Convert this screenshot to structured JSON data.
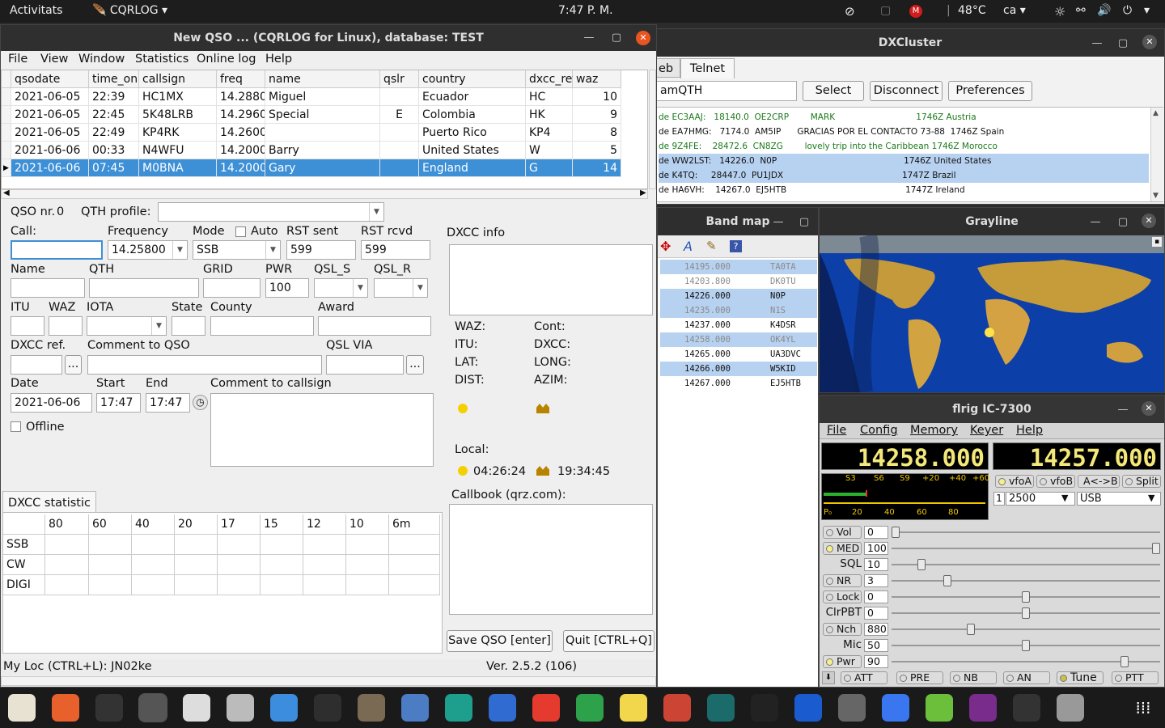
{
  "topbar": {
    "activities": "Activitats",
    "app": "CQRLOG",
    "clock": "7:47 P. M.",
    "temp": "48°C",
    "lang": "ca"
  },
  "qso_window": {
    "title": "New QSO ... (CQRLOG for Linux), database: TEST",
    "menu": [
      "File",
      "View",
      "Window",
      "Statistics",
      "Online log",
      "Help"
    ],
    "grid": {
      "headers": [
        "qsodate",
        "time_on",
        "callsign",
        "freq",
        "name",
        "qslr",
        "country",
        "dxcc_ref",
        "waz"
      ],
      "rows": [
        [
          "2021-06-05",
          "22:39",
          "HC1MX",
          "14.2880",
          "Miguel",
          "",
          "Ecuador",
          "HC",
          "10"
        ],
        [
          "2021-06-05",
          "22:45",
          "5K48LRB",
          "14.2960",
          "Special",
          "E",
          "Colombia",
          "HK",
          "9"
        ],
        [
          "2021-06-05",
          "22:49",
          "KP4RK",
          "14.2600",
          "",
          "",
          "Puerto Rico",
          "KP4",
          "8"
        ],
        [
          "2021-06-06",
          "00:33",
          "N4WFU",
          "14.2000",
          "Barry",
          "",
          "United States",
          "W",
          "5"
        ],
        [
          "2021-06-06",
          "07:45",
          "M0BNA",
          "14.2000",
          "Gary",
          "",
          "England",
          "G",
          "14"
        ]
      ]
    },
    "form": {
      "qso_nr_label": "QSO nr.",
      "qso_nr": "0",
      "qth_profile_label": "QTH profile:",
      "call_label": "Call:",
      "frequency_label": "Frequency",
      "frequency": "14.25800",
      "mode_label": "Mode",
      "mode": "SSB",
      "auto_label": "Auto",
      "rst_sent_label": "RST sent",
      "rst_sent": "599",
      "rst_rcvd_label": "RST rcvd",
      "rst_rcvd": "599",
      "name_label": "Name",
      "qth_label": "QTH",
      "grid_label": "GRID",
      "pwr_label": "PWR",
      "pwr": "100",
      "qsl_s_label": "QSL_S",
      "qsl_r_label": "QSL_R",
      "itu_label": "ITU",
      "waz_label": "WAZ",
      "iota_label": "IOTA",
      "state_label": "State",
      "county_label": "County",
      "award_label": "Award",
      "dxcc_ref_label": "DXCC ref.",
      "comment_qso_label": "Comment to QSO",
      "qsl_via_label": "QSL VIA",
      "date_label": "Date",
      "date": "2021-06-06",
      "start_label": "Start",
      "start": "17:47",
      "end_label": "End",
      "end": "17:47",
      "comment_call_label": "Comment to callsign",
      "offline_label": "Offline",
      "ellipsis": "..."
    },
    "dxcc_info": {
      "title": "DXCC info",
      "waz": "WAZ:",
      "itu": "ITU:",
      "lat": "LAT:",
      "dist": "DIST:",
      "cont": "Cont:",
      "dxcc": "DXCC:",
      "long": "LONG:",
      "azim": "AZIM:",
      "local": "Local:",
      "sunrise": "04:26:24",
      "sunset": "19:34:45",
      "callbook": "Callbook (qrz.com):"
    },
    "stat": {
      "tab": "DXCC statistic",
      "bands": [
        "80",
        "60",
        "40",
        "20",
        "17",
        "15",
        "12",
        "10",
        "6m"
      ],
      "modes": [
        "SSB",
        "CW",
        "DIGI"
      ]
    },
    "save_btn": "Save QSO [enter]",
    "quit_btn": "Quit [CTRL+Q]",
    "status_left": "My Loc (CTRL+L): JN02ke",
    "status_right": "Ver. 2.5.2 (106)"
  },
  "dxcluster": {
    "title": "DXCluster",
    "tab_web": "eb",
    "tab_telnet": "Telnet",
    "host": "amQTH",
    "select": "Select",
    "disconnect": "Disconnect",
    "preferences": "Preferences",
    "lines": [
      {
        "text": "de EC3AAJ:   18140.0  OE2CRP        MARK                              1746Z Austria",
        "color": "#1a7a1a",
        "hl": false
      },
      {
        "text": "de EA7HMG:   7174.0  AM5IP      GRACIAS POR EL CONTACTO 73-88  1746Z Spain",
        "color": "#111",
        "hl": false
      },
      {
        "text": "de 9Z4FE:    28472.6  CN8ZG        lovely trip into the Caribbean 1746Z Morocco",
        "color": "#1a7a1a",
        "hl": false
      },
      {
        "text": "de WW2LST:   14226.0  N0P                                               1746Z United States",
        "color": "#111",
        "hl": true
      },
      {
        "text": "de K4TQ:     28447.0  PU1JDX                                            1747Z Brazil",
        "color": "#111",
        "hl": true
      },
      {
        "text": "de HA6VH:    14267.0  EJ5HTB                                            1747Z Ireland",
        "color": "#111",
        "hl": false
      }
    ]
  },
  "bandmap": {
    "title": "Band map",
    "rows": [
      {
        "freq": "14195.000",
        "call": "TA0TA",
        "hl": true,
        "dim": true
      },
      {
        "freq": "14203.800",
        "call": "DK0TU",
        "hl": false,
        "dim": true
      },
      {
        "freq": "14226.000",
        "call": "N0P",
        "hl": true,
        "dim": false
      },
      {
        "freq": "14235.000",
        "call": "N1S",
        "hl": true,
        "dim": true
      },
      {
        "freq": "14237.000",
        "call": "K4DSR",
        "hl": false,
        "dim": false
      },
      {
        "freq": "14258.000",
        "call": "OK4YL",
        "hl": true,
        "dim": true
      },
      {
        "freq": "14265.000",
        "call": "UA3DVC",
        "hl": false,
        "dim": false
      },
      {
        "freq": "14266.000",
        "call": "W5KID",
        "hl": true,
        "dim": false
      },
      {
        "freq": "14267.000",
        "call": "EJ5HTB",
        "hl": false,
        "dim": false
      }
    ]
  },
  "grayline": {
    "title": "Grayline"
  },
  "flrig": {
    "title": "flrig IC-7300",
    "menu": [
      "File",
      "Config",
      "Memory",
      "Keyer",
      "Help"
    ],
    "vfo_a": "14258.000",
    "vfo_b": "14257.000",
    "smeter_labels": [
      "S3",
      "S6",
      "S9",
      "+20",
      "+40",
      "+60"
    ],
    "pwr_labels": [
      "20",
      "40",
      "60",
      "80"
    ],
    "btn_vfoa": "vfoA",
    "btn_vfob": "vfoB",
    "btn_ab": "A<->B",
    "btn_split": "Split",
    "bw_idx": "1",
    "bw": "2500",
    "mode": "USB",
    "controls": [
      {
        "label": "Vol",
        "value": "0",
        "btn": true,
        "active": false,
        "pos": 0.0
      },
      {
        "label": "MED",
        "value": "100",
        "btn": true,
        "active": true,
        "pos": 1.0
      },
      {
        "label": "SQL",
        "value": "10",
        "btn": false,
        "active": false,
        "pos": 0.1
      },
      {
        "label": "NR",
        "value": "3",
        "btn": true,
        "active": false,
        "pos": 0.2
      },
      {
        "label": "Lock",
        "value": "0",
        "btn": true,
        "active": false,
        "pos": 0.5
      },
      {
        "label": "ClrPBT",
        "value": "0",
        "btn": false,
        "active": false,
        "pos": 0.5
      },
      {
        "label": "Nch",
        "value": "880",
        "btn": true,
        "active": false,
        "pos": 0.29
      },
      {
        "label": "Mic",
        "value": "50",
        "btn": false,
        "active": false,
        "pos": 0.5
      },
      {
        "label": "Pwr",
        "value": "90",
        "btn": true,
        "active": true,
        "pos": 0.88
      }
    ],
    "bottom": [
      "ATT",
      "PRE",
      "NB",
      "AN",
      "Tune",
      "PTT"
    ]
  }
}
